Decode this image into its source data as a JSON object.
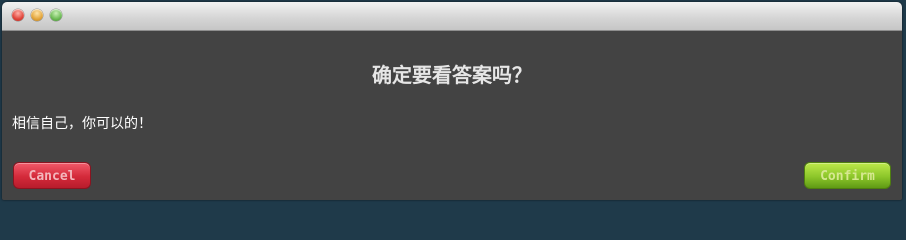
{
  "window": {
    "controls": [
      "close-button",
      "minimize-button",
      "zoom-button"
    ]
  },
  "dialog": {
    "title": "确定要看答案吗？",
    "message": "相信自己，你可以的！"
  },
  "buttons": {
    "cancel_label": "Cancel",
    "confirm_label": "Confirm"
  },
  "colors": {
    "background": "#434343",
    "cancel": "#d42a3a",
    "confirm": "#8cc62a"
  }
}
